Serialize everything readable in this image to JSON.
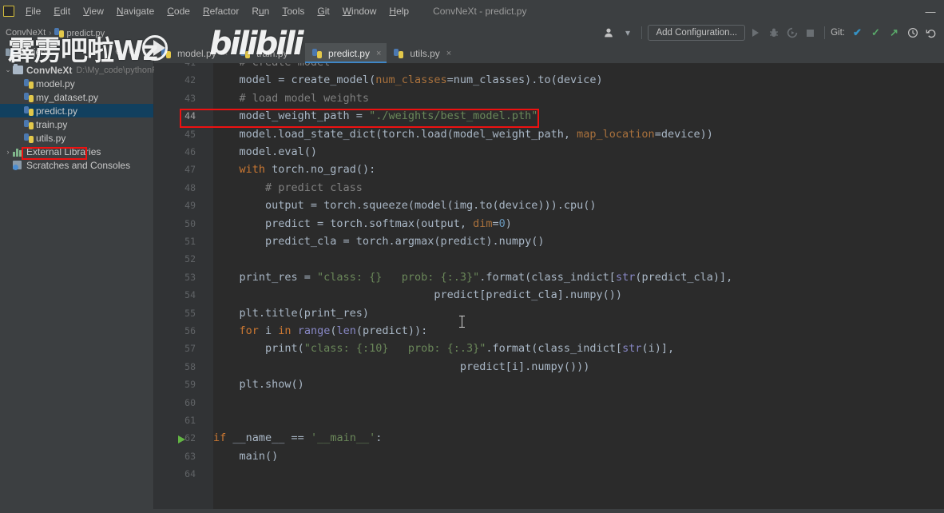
{
  "window": {
    "title": "ConvNeXt - predict.py",
    "minimize_label": "—"
  },
  "menubar": {
    "items": [
      {
        "label": "File"
      },
      {
        "label": "Edit"
      },
      {
        "label": "View"
      },
      {
        "label": "Navigate"
      },
      {
        "label": "Code"
      },
      {
        "label": "Refactor"
      },
      {
        "label": "Run"
      },
      {
        "label": "Tools"
      },
      {
        "label": "Git"
      },
      {
        "label": "Window"
      },
      {
        "label": "Help"
      }
    ]
  },
  "breadcrumb": {
    "project": "ConvNeXt",
    "separator": "›",
    "file": "predict.py"
  },
  "toolbar": {
    "user_icon": "user-avatar-icon",
    "dropdown_caret": "▾",
    "add_configuration": "Add Configuration...",
    "run": "run-icon",
    "debug": "debug-icon",
    "coverage": "run-with-coverage-icon",
    "stop": "stop-icon",
    "git_label": "Git:",
    "git_update": "✔",
    "git_commit": "✓",
    "git_push": "↗",
    "history": "🕐",
    "rollback": "↺"
  },
  "project_panel": {
    "title": "Project",
    "header_icons": [
      "collapse-all-icon",
      "settings-icon",
      "hide-icon"
    ],
    "tree": [
      {
        "label": "ConvNeXt",
        "path": "D:\\My_code\\pythonP",
        "type": "folder",
        "arrow": "⌄",
        "indent": 0,
        "selected": false,
        "bold": true
      },
      {
        "label": "model.py",
        "path": "",
        "type": "python",
        "arrow": "",
        "indent": 1,
        "selected": false,
        "bold": false
      },
      {
        "label": "my_dataset.py",
        "path": "",
        "type": "python",
        "arrow": "",
        "indent": 1,
        "selected": false,
        "bold": false
      },
      {
        "label": "predict.py",
        "path": "",
        "type": "python",
        "arrow": "",
        "indent": 1,
        "selected": true,
        "bold": false
      },
      {
        "label": "train.py",
        "path": "",
        "type": "python",
        "arrow": "",
        "indent": 1,
        "selected": false,
        "bold": false
      },
      {
        "label": "utils.py",
        "path": "",
        "type": "python",
        "arrow": "",
        "indent": 1,
        "selected": false,
        "bold": false
      },
      {
        "label": "External Libraries",
        "path": "",
        "type": "library",
        "arrow": "›",
        "indent": 0,
        "selected": false,
        "bold": false
      },
      {
        "label": "Scratches and Consoles",
        "path": "",
        "type": "scratch",
        "arrow": "",
        "indent": 0,
        "selected": false,
        "bold": false
      }
    ]
  },
  "tabs": [
    {
      "label": "model.py",
      "active": false,
      "close": "×"
    },
    {
      "label": "train.py",
      "active": false,
      "close": "×"
    },
    {
      "label": "predict.py",
      "active": true,
      "close": "×"
    },
    {
      "label": "utils.py",
      "active": false,
      "close": "×"
    }
  ],
  "editor": {
    "first_line_number": 41,
    "current_line_number": 44,
    "lines": [
      {
        "n": 41,
        "tokens": [
          {
            "t": "    # create model",
            "c": "cm"
          }
        ]
      },
      {
        "n": 42,
        "tokens": [
          {
            "t": "    model = create_model(",
            "c": "fn"
          },
          {
            "t": "num_classes",
            "c": "pa"
          },
          {
            "t": "=num_classes).to(device)",
            "c": "fn"
          }
        ]
      },
      {
        "n": 43,
        "tokens": [
          {
            "t": "    # load model weights",
            "c": "cm"
          }
        ]
      },
      {
        "n": 44,
        "tokens": [
          {
            "t": "    model_weight_path = ",
            "c": "fn"
          },
          {
            "t": "\"./weights/best_model.pth\"",
            "c": "st"
          }
        ]
      },
      {
        "n": 45,
        "tokens": [
          {
            "t": "    model.load_state_dict(torch.load(model_weight_path, ",
            "c": "fn"
          },
          {
            "t": "map_location",
            "c": "pa"
          },
          {
            "t": "=device))",
            "c": "fn"
          }
        ]
      },
      {
        "n": 46,
        "tokens": [
          {
            "t": "    model.eval()",
            "c": "fn"
          }
        ]
      },
      {
        "n": 47,
        "tokens": [
          {
            "t": "    with",
            "c": "kw"
          },
          {
            "t": " torch.no_grad():",
            "c": "fn"
          }
        ]
      },
      {
        "n": 48,
        "tokens": [
          {
            "t": "        # predict class",
            "c": "cm"
          }
        ]
      },
      {
        "n": 49,
        "tokens": [
          {
            "t": "        output = torch.squeeze(model(img.to(device))).cpu()",
            "c": "fn"
          }
        ]
      },
      {
        "n": 50,
        "tokens": [
          {
            "t": "        predict = torch.softmax(output, ",
            "c": "fn"
          },
          {
            "t": "dim",
            "c": "pa"
          },
          {
            "t": "=",
            "c": "fn"
          },
          {
            "t": "0",
            "c": "nm"
          },
          {
            "t": ")",
            "c": "fn"
          }
        ]
      },
      {
        "n": 51,
        "tokens": [
          {
            "t": "        predict_cla = torch.argmax(predict).numpy()",
            "c": "fn"
          }
        ]
      },
      {
        "n": 52,
        "tokens": [
          {
            "t": "",
            "c": "fn"
          }
        ]
      },
      {
        "n": 53,
        "tokens": [
          {
            "t": "    print_res = ",
            "c": "fn"
          },
          {
            "t": "\"class: {}   prob: {:.3}\"",
            "c": "st"
          },
          {
            "t": ".format(class_indict[",
            "c": "fn"
          },
          {
            "t": "str",
            "c": "bi"
          },
          {
            "t": "(predict_cla)],",
            "c": "fn"
          }
        ]
      },
      {
        "n": 54,
        "tokens": [
          {
            "t": "                                  predict[predict_cla].numpy())",
            "c": "fn"
          }
        ]
      },
      {
        "n": 55,
        "tokens": [
          {
            "t": "    plt.title(print_res)",
            "c": "fn"
          }
        ]
      },
      {
        "n": 56,
        "tokens": [
          {
            "t": "    for",
            "c": "kw"
          },
          {
            "t": " i ",
            "c": "fn"
          },
          {
            "t": "in",
            "c": "kw"
          },
          {
            "t": " ",
            "c": "fn"
          },
          {
            "t": "range",
            "c": "bi"
          },
          {
            "t": "(",
            "c": "fn"
          },
          {
            "t": "len",
            "c": "bi"
          },
          {
            "t": "(predict)):",
            "c": "fn"
          }
        ]
      },
      {
        "n": 57,
        "tokens": [
          {
            "t": "        print(",
            "c": "fn"
          },
          {
            "t": "\"class: {:10}   prob: {:.3}\"",
            "c": "st"
          },
          {
            "t": ".format(class_indict[",
            "c": "fn"
          },
          {
            "t": "str",
            "c": "bi"
          },
          {
            "t": "(i)],",
            "c": "fn"
          }
        ]
      },
      {
        "n": 58,
        "tokens": [
          {
            "t": "                                      predict[i].numpy()))",
            "c": "fn"
          }
        ]
      },
      {
        "n": 59,
        "tokens": [
          {
            "t": "    plt.show()",
            "c": "fn"
          }
        ]
      },
      {
        "n": 60,
        "tokens": [
          {
            "t": "",
            "c": "fn"
          }
        ]
      },
      {
        "n": 61,
        "tokens": [
          {
            "t": "",
            "c": "fn"
          }
        ]
      },
      {
        "n": 62,
        "tokens": [
          {
            "t": "if",
            "c": "kw"
          },
          {
            "t": " __name__ == ",
            "c": "fn"
          },
          {
            "t": "'__main__'",
            "c": "st"
          },
          {
            "t": ":",
            "c": "fn"
          }
        ]
      },
      {
        "n": 63,
        "tokens": [
          {
            "t": "    main()",
            "c": "fn"
          }
        ]
      },
      {
        "n": 64,
        "tokens": [
          {
            "t": "",
            "c": "fn"
          }
        ]
      }
    ]
  },
  "annotations": {
    "highlight_color": "#ee1111",
    "boxes": [
      {
        "name": "model-weight-path-highlight",
        "target_line": 44
      },
      {
        "name": "predict-py-sidebar-highlight",
        "target": "predict.py"
      }
    ]
  },
  "watermark": {
    "channel": "霹雳吧啦Wz",
    "platform": "bilibili"
  },
  "colors": {
    "editor_background": "#2b2b2b",
    "gutter_background": "#313335",
    "panel_background": "#3c3f41",
    "selection_blue": "#11405f",
    "tab_active": "#4e5254",
    "accent_underline": "#3f86c6",
    "string_green": "#6a8759",
    "keyword_orange": "#cc7832",
    "comment_gray": "#808080",
    "number_blue": "#6897bb",
    "param_brown": "#a9713c"
  }
}
